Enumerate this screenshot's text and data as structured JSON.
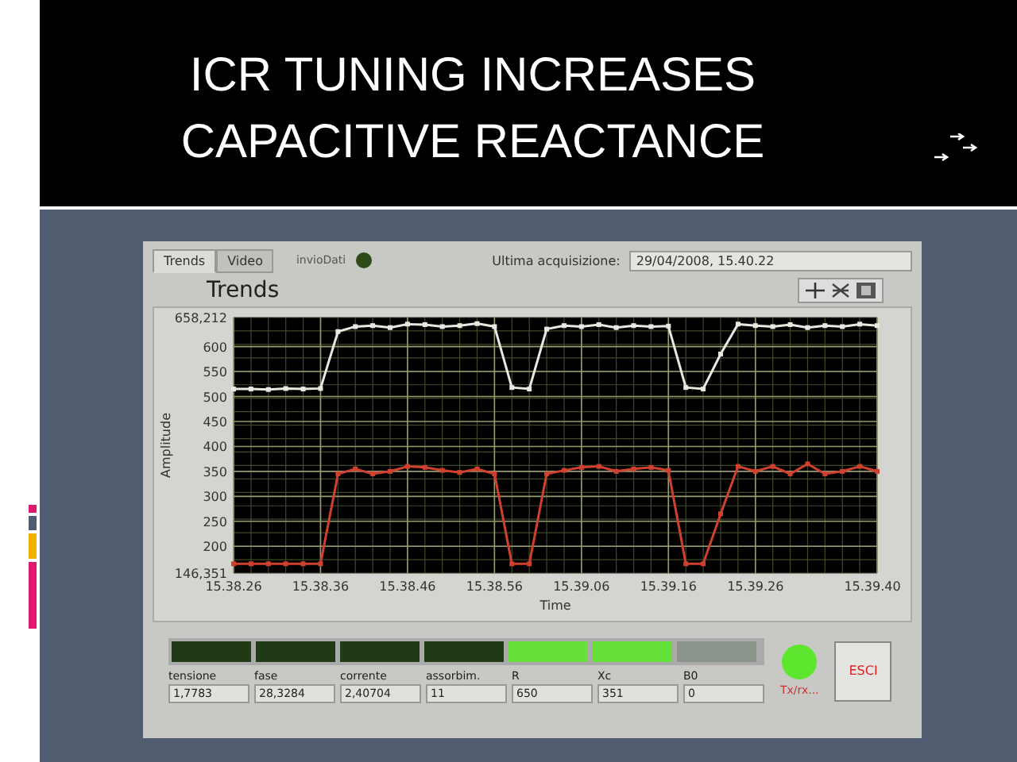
{
  "slide": {
    "title_lines": [
      "ICR TUNING INCREASES",
      "CAPACITIVE REACTANCE"
    ]
  },
  "panel": {
    "tabs": [
      {
        "label": "Trends",
        "selected": true
      },
      {
        "label": "Video",
        "selected": false
      }
    ],
    "invio": {
      "label": "invioDati",
      "on": false
    },
    "acquisition": {
      "label": "Ultima acquisizione:",
      "value": "29/04/2008, 15.40.22"
    },
    "graph_title": "Trends",
    "chart_data": {
      "type": "line",
      "xlabel": "Time",
      "ylabel": "Amplitude",
      "categories": [
        "15.38.26",
        null,
        null,
        null,
        null,
        "15.38.36",
        null,
        null,
        null,
        null,
        "15.38.46",
        null,
        null,
        null,
        null,
        "15.38.56",
        null,
        null,
        null,
        null,
        "15.39.06",
        null,
        null,
        null,
        null,
        "15.39.16",
        null,
        null,
        null,
        null,
        "15.39.26",
        null,
        null,
        null,
        null,
        null,
        null,
        "15.39.40"
      ],
      "series": [
        {
          "color": "#e8e8e0",
          "marker": "square",
          "values": [
            515,
            515,
            514,
            516,
            515,
            516,
            630,
            640,
            642,
            638,
            645,
            644,
            640,
            642,
            646,
            640,
            518,
            515,
            635,
            642,
            640,
            644,
            638,
            642,
            640,
            641,
            518,
            515,
            585,
            645,
            642,
            640,
            644,
            638,
            642,
            640,
            645,
            642
          ]
        },
        {
          "color": "#d0402e",
          "marker": "square",
          "values": [
            165,
            165,
            165,
            165,
            165,
            165,
            345,
            355,
            345,
            350,
            360,
            358,
            352,
            348,
            355,
            345,
            165,
            165,
            345,
            352,
            358,
            360,
            350,
            355,
            358,
            352,
            165,
            165,
            265,
            360,
            350,
            360,
            345,
            365,
            345,
            350,
            360,
            350
          ]
        }
      ],
      "ylim": [
        146.351,
        658.212
      ],
      "grid": true,
      "yticks": [
        200,
        250,
        300,
        350,
        400,
        450,
        500,
        550,
        600
      ]
    },
    "axis_limits": [
      "658,212",
      "146,351"
    ],
    "leds": [
      {
        "on": false,
        "disabled": false
      },
      {
        "on": false,
        "disabled": false
      },
      {
        "on": false,
        "disabled": false
      },
      {
        "on": false,
        "disabled": false
      },
      {
        "on": true,
        "disabled": false
      },
      {
        "on": true,
        "disabled": false
      },
      {
        "on": false,
        "disabled": true
      }
    ],
    "fields": [
      {
        "label": "tensione",
        "value": "1,7783"
      },
      {
        "label": "fase",
        "value": "28,3284"
      },
      {
        "label": "corrente",
        "value": "2,40704"
      },
      {
        "label": "assorbim.",
        "value": "11"
      },
      {
        "label": "R",
        "value": "650"
      },
      {
        "label": "Xc",
        "value": "351"
      },
      {
        "label": "B0",
        "value": "0"
      }
    ],
    "txrx": {
      "label": "Tx/rx...",
      "on": true
    },
    "exit_button": "ESCI"
  }
}
